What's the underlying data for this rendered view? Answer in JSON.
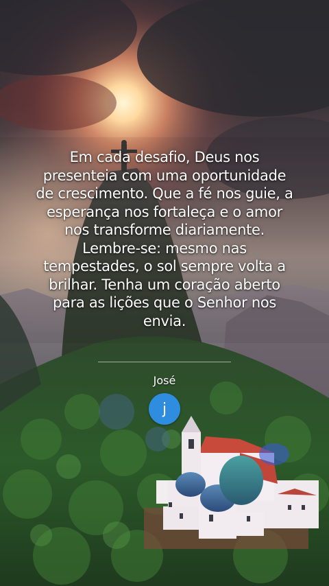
{
  "quote": {
    "text": "Em cada desafio, Deus nos presenteia com uma oportunidade de crescimento. Que a fé nos guie, a esperança nos fortaleça e o amor nos transforme diariamente. Lembre-se: mesmo nas tempestades, o sol sempre volta a brilhar. Tenha um coração aberto para as lições que o Senhor nos envia."
  },
  "author": {
    "name": "José",
    "avatar_initial": "j"
  },
  "colors": {
    "avatar_bg": "#2f8de0",
    "text": "#ffffff"
  },
  "background": {
    "image": "sunset-mountain-statue-chapel"
  }
}
